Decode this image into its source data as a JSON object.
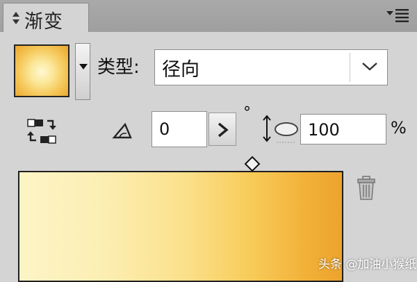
{
  "panel": {
    "title": "渐变"
  },
  "type": {
    "label": "类型:",
    "value": "径向"
  },
  "angle": {
    "value": "0",
    "unit": "°"
  },
  "aspect": {
    "value": "100",
    "unit": "%"
  },
  "colors": {
    "gradient_start": "#fdf4c6",
    "gradient_mid": "#fbe08a",
    "gradient_end": "#eda32e"
  },
  "watermark": {
    "text": "头条 @加油小猴纸"
  }
}
